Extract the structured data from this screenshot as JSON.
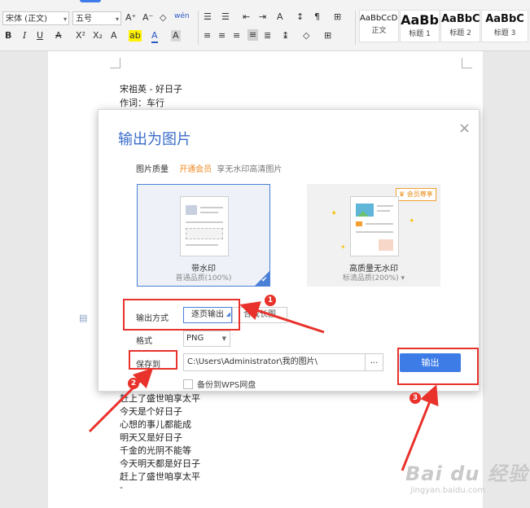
{
  "ribbon": {
    "font_name": "宋体 (正文)",
    "font_size": "五号",
    "grow_font": "A⁺",
    "shrink_font": "A⁻",
    "clear_format": "◇",
    "phonetic": "wén",
    "bold": "B",
    "italic": "I",
    "underline": "U",
    "strikethrough": "A",
    "superscript": "X²",
    "subscript": "X₂",
    "text_effect": "A",
    "highlight": "ab",
    "font_color": "A",
    "char_shade": "A",
    "styles": [
      {
        "preview": "AaBbCcDd",
        "name": "正文"
      },
      {
        "preview": "AaBb",
        "name": "标题 1"
      },
      {
        "preview": "AaBbC",
        "name": "标题 2"
      },
      {
        "preview": "AaBbC",
        "name": "标题 3"
      }
    ]
  },
  "document": {
    "top_lines": [
      "宋祖英 - 好日子",
      "作词：车行"
    ],
    "bottom_lines": [
      "赶上了盛世咱享太平",
      "今天是个好日子",
      "心想的事儿都能成",
      "明天又是好日子",
      "千金的光阴不能等",
      "今天明天都是好日子",
      "赶上了盛世咱享太平",
      "-"
    ]
  },
  "dialog": {
    "title": "输出为图片",
    "close": "×",
    "quality_label": "图片质量",
    "vip_link": "开通会员",
    "vip_desc": "享无水印高清图片",
    "card_watermark": {
      "title": "带水印",
      "subtitle": "普通品质(100%)"
    },
    "card_hq": {
      "badge": "会员尊享",
      "title": "高质量无水印",
      "subtitle": "标清品质(200%)",
      "dropdown": "▾"
    },
    "mode_label": "输出方式",
    "mode_selected": "逐页输出",
    "mode_other": "合成长图",
    "format_label": "格式",
    "format_value": "PNG",
    "save_label": "保存到",
    "save_path": "C:\\Users\\Administrator\\我的图片\\",
    "browse": "...",
    "export_button": "输出",
    "backup_label": "备份到WPS网盘"
  },
  "annotations": {
    "badges": [
      "1",
      "2",
      "3"
    ],
    "color": "#e8322b"
  },
  "watermark": {
    "brand": "Bai du 经验",
    "url": "jingyan.baidu.com"
  },
  "colors": {
    "accent": "#3d7be6",
    "vip": "#f08a24"
  }
}
